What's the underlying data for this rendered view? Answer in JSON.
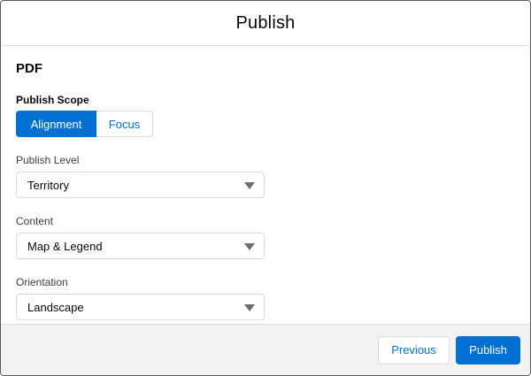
{
  "modal": {
    "title": "Publish"
  },
  "section": {
    "title": "PDF"
  },
  "publish_scope": {
    "label": "Publish Scope",
    "options": [
      "Alignment",
      "Focus"
    ],
    "selected": "Alignment"
  },
  "publish_level": {
    "label": "Publish Level",
    "value": "Territory"
  },
  "content": {
    "label": "Content",
    "value": "Map & Legend"
  },
  "orientation": {
    "label": "Orientation",
    "value": "Landscape"
  },
  "footer": {
    "previous_label": "Previous",
    "publish_label": "Publish"
  },
  "colors": {
    "brand": "#0070d2",
    "footer_bg": "#f3f2f2",
    "border": "#dddbda"
  },
  "icons": {
    "dropdown": "chevron-down-icon"
  }
}
